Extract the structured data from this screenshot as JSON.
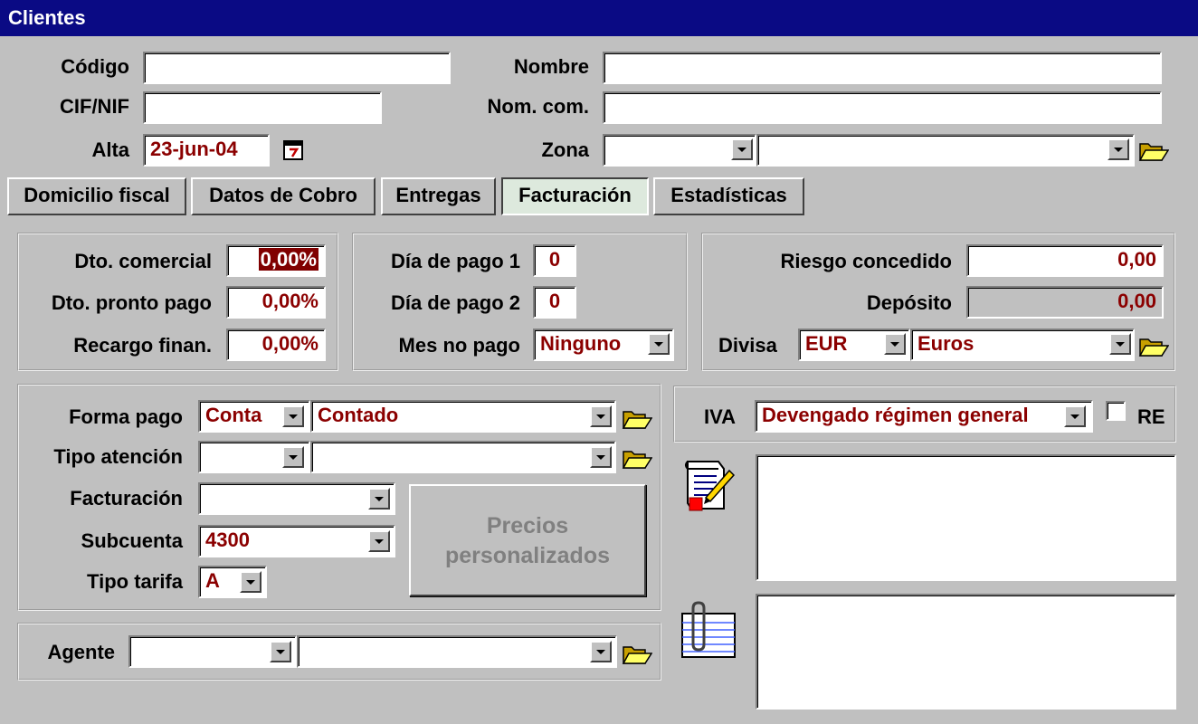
{
  "window": {
    "title": "Clientes"
  },
  "header": {
    "codigo_label": "Código",
    "codigo_value": "",
    "cif_label": "CIF/NIF",
    "cif_value": "",
    "alta_label": "Alta",
    "alta_value": "23-jun-04",
    "nombre_label": "Nombre",
    "nombre_value": "",
    "nomcom_label": "Nom. com.",
    "nomcom_value": "",
    "zona_label": "Zona",
    "zona_code": "",
    "zona_name": ""
  },
  "tabs": [
    {
      "label": "Domicilio fiscal"
    },
    {
      "label": "Datos de Cobro"
    },
    {
      "label": "Entregas"
    },
    {
      "label": "Facturación"
    },
    {
      "label": "Estadísticas"
    }
  ],
  "discounts": {
    "dto_comercial_label": "Dto. comercial",
    "dto_comercial_value": "0,00%",
    "dto_pronto_label": "Dto. pronto pago",
    "dto_pronto_value": "0,00%",
    "recargo_label": "Recargo finan.",
    "recargo_value": "0,00%"
  },
  "payment_days": {
    "dia1_label": "Día de pago 1",
    "dia1_value": "0",
    "dia2_label": "Día de pago 2",
    "dia2_value": "0",
    "mes_label": "Mes no pago",
    "mes_value": "Ninguno"
  },
  "risk": {
    "riesgo_label": "Riesgo concedido",
    "riesgo_value": "0,00",
    "deposito_label": "Depósito",
    "deposito_value": "0,00",
    "divisa_label": "Divisa",
    "divisa_code": "EUR",
    "divisa_name": "Euros"
  },
  "billing": {
    "forma_label": "Forma pago",
    "forma_code": "Conta",
    "forma_name": "Contado",
    "tipo_atencion_label": "Tipo atención",
    "tipo_atencion_code": "",
    "tipo_atencion_name": "",
    "facturacion_label": "Facturación",
    "facturacion_value": "",
    "subcuenta_label": "Subcuenta",
    "subcuenta_value": "4300",
    "tarifa_label": "Tipo tarifa",
    "tarifa_value": "A",
    "precios_line1": "Precios",
    "precios_line2": "personalizados"
  },
  "tax": {
    "iva_label": "IVA",
    "iva_value": "Devengado régimen general",
    "re_label": "RE"
  },
  "agent": {
    "agente_label": "Agente",
    "agente_code": "",
    "agente_name": ""
  },
  "icons": {
    "calendar": "calendar-icon",
    "folder": "open-folder-icon",
    "notes": "notes-icon",
    "attachments": "attachment-icon"
  }
}
